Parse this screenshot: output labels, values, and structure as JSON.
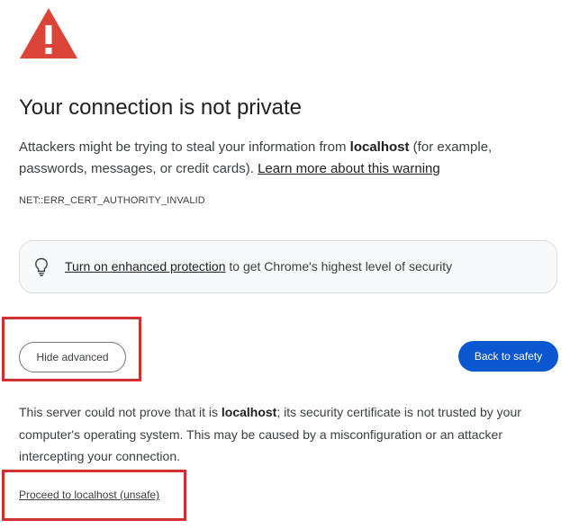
{
  "page": {
    "title": "Your connection is not private",
    "description": {
      "prefix": "Attackers might be trying to steal your information from ",
      "host": "localhost",
      "suffix": " (for example, passwords, messages, or credit cards). ",
      "learn_more_link": "Learn more about this warning"
    },
    "error_code": "NET::ERR_CERT_AUTHORITY_INVALID",
    "enhanced_protection": {
      "icon": "lightbulb-icon",
      "link_text": "Turn on enhanced protection",
      "suffix": " to get Chrome's highest level of security"
    },
    "buttons": {
      "hide_advanced": "Hide advanced",
      "back_to_safety": "Back to safety"
    },
    "details": {
      "prefix": "This server could not prove that it is ",
      "host": "localhost",
      "suffix": "; its security certificate is not trusted by your computer's operating system. This may be caused by a misconfiguration or an attacker intercepting your connection."
    },
    "proceed_link": "Proceed to localhost (unsafe)"
  },
  "colors": {
    "warning_red": "#db4437",
    "primary_blue": "#0b57d0",
    "highlight_red": "#d32f2f"
  },
  "icons": {
    "warning": "warning-triangle-icon"
  }
}
